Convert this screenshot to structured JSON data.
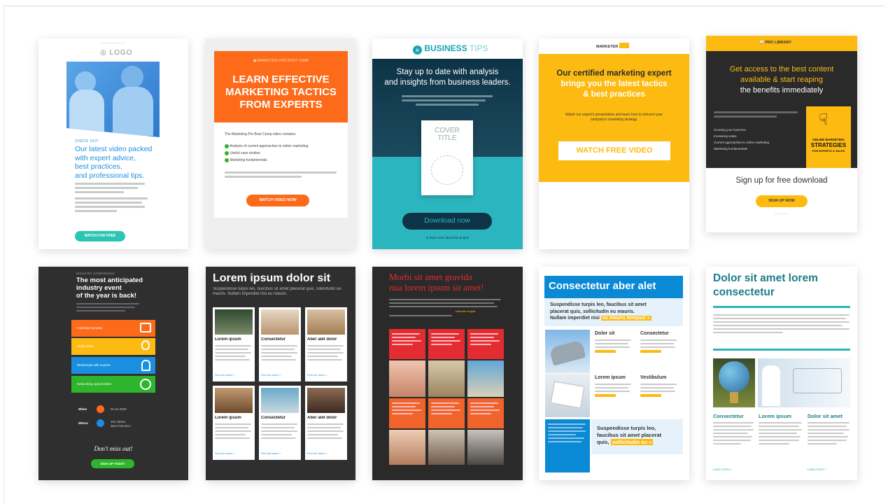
{
  "colors": {
    "orange": "#fd6b1a",
    "teal": "#2bb5bf",
    "navy": "#0d3346",
    "yellow": "#fdbb12",
    "green": "#2db52b",
    "blue": "#0a89d4",
    "dark": "#2f2f2f",
    "red": "#e32c32",
    "sea": "#1c9bb3"
  },
  "templates": {
    "t1": {
      "logo": "LOGO",
      "kicker": "CHECK OUT",
      "headline1": "Our latest video packed",
      "headline2": "with expert advice,",
      "headline3": "best practices,",
      "headline4": "and professional tips.",
      "button": "WATCH FOR FREE"
    },
    "t2": {
      "brand": "MARKETING PRO BOOT CAMP",
      "headline1": "LEARN EFFECTIVE",
      "headline2": "MARKETING TACTICS",
      "headline3": "FROM EXPERTS",
      "intro": "The Marketing Pro Boot Camp video contains:",
      "bullet1": "Analysis of current approaches to online marketing",
      "bullet2": "Useful case studies",
      "bullet3": "Marketing fundamentals",
      "button": "WATCH VIDEO NOW"
    },
    "t3": {
      "brand_bold": "BUSINESS",
      "brand_light": " TIPS",
      "headline1": "Stay up to date with analysis",
      "headline2": "and insights from business leaders.",
      "cover1": "COVER",
      "cover2": "TITLE",
      "button": "Download now",
      "link": "or learn more about the project"
    },
    "t4": {
      "brand": "MARKETER",
      "headline1": "Our certified marketing expert",
      "headline2": "brings you the latest tactics",
      "headline3": "& best practices",
      "body": "Watch our expert's presentation and learn how to reinvent your company's marketing strategy.",
      "button": "WATCH FREE VIDEO"
    },
    "t5": {
      "brand": "PRO LIBRARY",
      "headline1": "Get access to the best content",
      "headline2": "available & start reaping",
      "headline3": "the benefits immediately",
      "book1": "ONLINE MARKETING",
      "book2": "STRATEGIES",
      "book3": "FOR EXPERTS & SALES",
      "bullet1": "Growing your business",
      "bullet2": "Increasing sales",
      "bullet3": "Current approaches to online marketing",
      "bullet4": "Marketing fundamentals",
      "signup": "Sign up for free download",
      "button": "SIGN UP NOW"
    },
    "t6": {
      "kicker": "INDUSTRY CONFERENCE",
      "headline1": "The most anticipated",
      "headline2": "industry event",
      "headline3": "of the year is back!",
      "row1": "Inspiring keynotes",
      "row2": "Bright ideas",
      "row3": "Workshops with experts",
      "row4": "Networking opportunities",
      "when_label": "When",
      "when_value": "01.01.2020",
      "where_label": "Where",
      "where_value1": "101 Street,",
      "where_value2": "San Francisco",
      "closing": "Don't miss out!",
      "button": "SIGN UP TODAY"
    },
    "t7": {
      "headline": "Lorem ipsum dolor sit",
      "sub": "Suspendisse turpis leo, faucibus sit amet placerat quis, sollicitudin eu mauris. Nullam imperdiet nisi eu mauris.",
      "c1": "Lorem ipsum",
      "c2": "Consectetur",
      "c3": "Aber alet dolor",
      "c4": "Lorem ipsum",
      "c5": "Consectetur",
      "c6": "Aber alet dolor",
      "more": "Find out more »"
    },
    "t8": {
      "headline1": "Morbi sit amet gravida",
      "headline2": "nua lorem ipsum sit amet!",
      "highlight": "Interdum feugiat"
    },
    "t9": {
      "headline": "Consectetur aber alet",
      "sub1": "Suspendisse turpis leo, faucibus sit amet",
      "sub2": "placerat quis, sollicitudin eu mauris.",
      "sub3a": "Nullam imperdiet nisi ",
      "sub3b": "eu mauris tempus! »",
      "h1": "Dolor sit",
      "h2": "Consectetur",
      "h3": "Lorem ipsum",
      "h4": "Vestibulum",
      "bottom1": "Suspendisse turpis leo,",
      "bottom2": "faucibus sit amet placerat",
      "bottom3a": "quis, ",
      "bottom3b": "sollicitudin eu »"
    },
    "t10": {
      "headline1": "Dolor sit amet lorem",
      "headline2": "consectetur",
      "col1": "Consectetur",
      "col2": "Lorem ipsum",
      "col3": "Dolor sit amet",
      "more": "Learn more »"
    }
  }
}
